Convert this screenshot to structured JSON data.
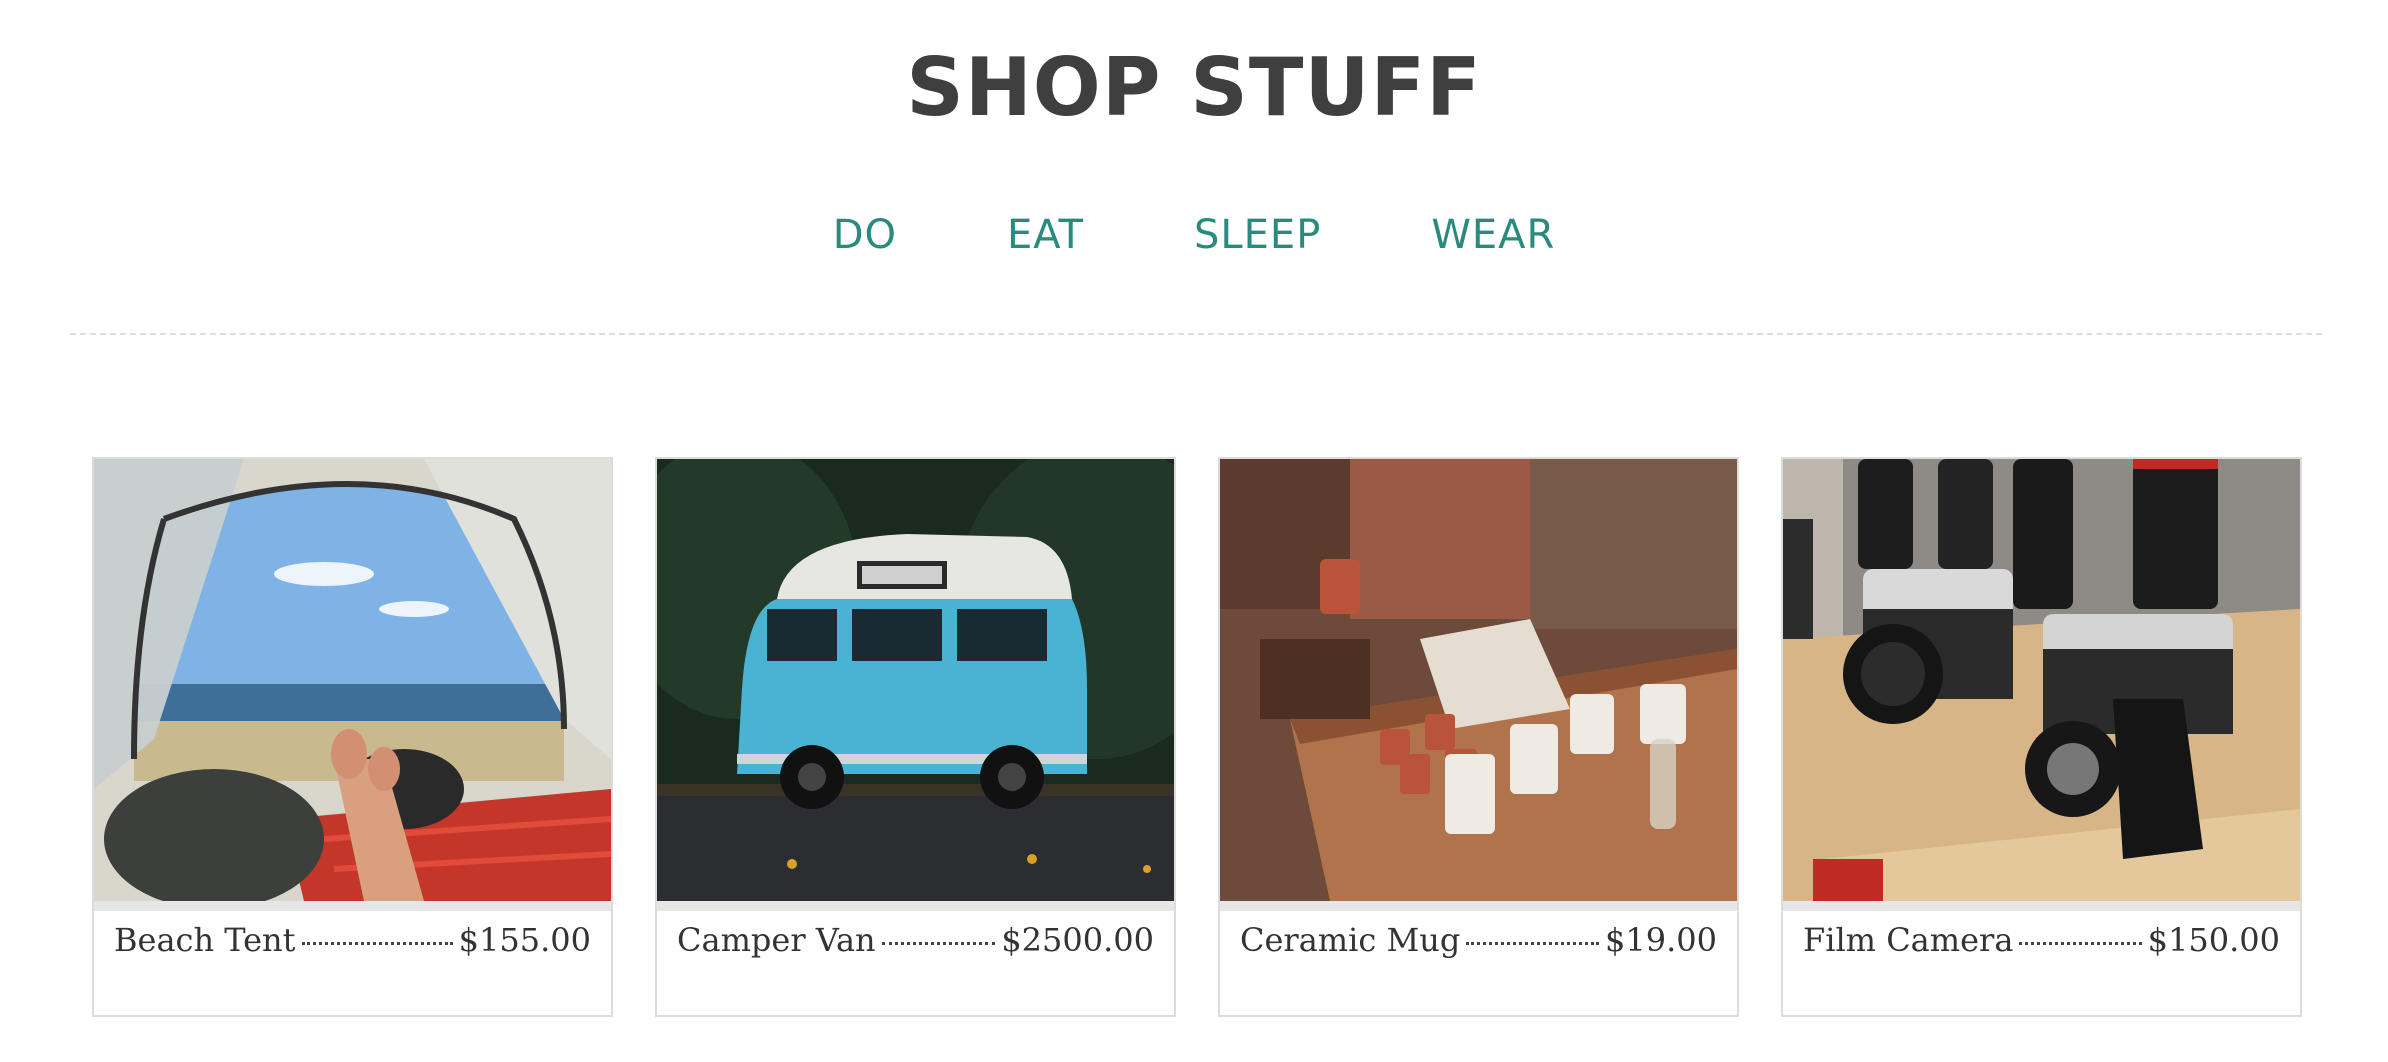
{
  "site": {
    "title": "SHOP STUFF"
  },
  "nav": {
    "items": [
      {
        "label": "DO"
      },
      {
        "label": "EAT"
      },
      {
        "label": "SLEEP"
      },
      {
        "label": "WEAR"
      }
    ],
    "link_color": "#2a8a7d"
  },
  "products": [
    {
      "name": "Beach Tent",
      "price": "$155.00",
      "image": "tent-beach-photo"
    },
    {
      "name": "Camper Van",
      "price": "$2500.00",
      "image": "blue-camper-van-photo"
    },
    {
      "name": "Ceramic Mug",
      "price": "$19.00",
      "image": "ceramic-mugs-table-photo"
    },
    {
      "name": "Film Camera",
      "price": "$150.00",
      "image": "film-cameras-shelf-photo"
    }
  ]
}
